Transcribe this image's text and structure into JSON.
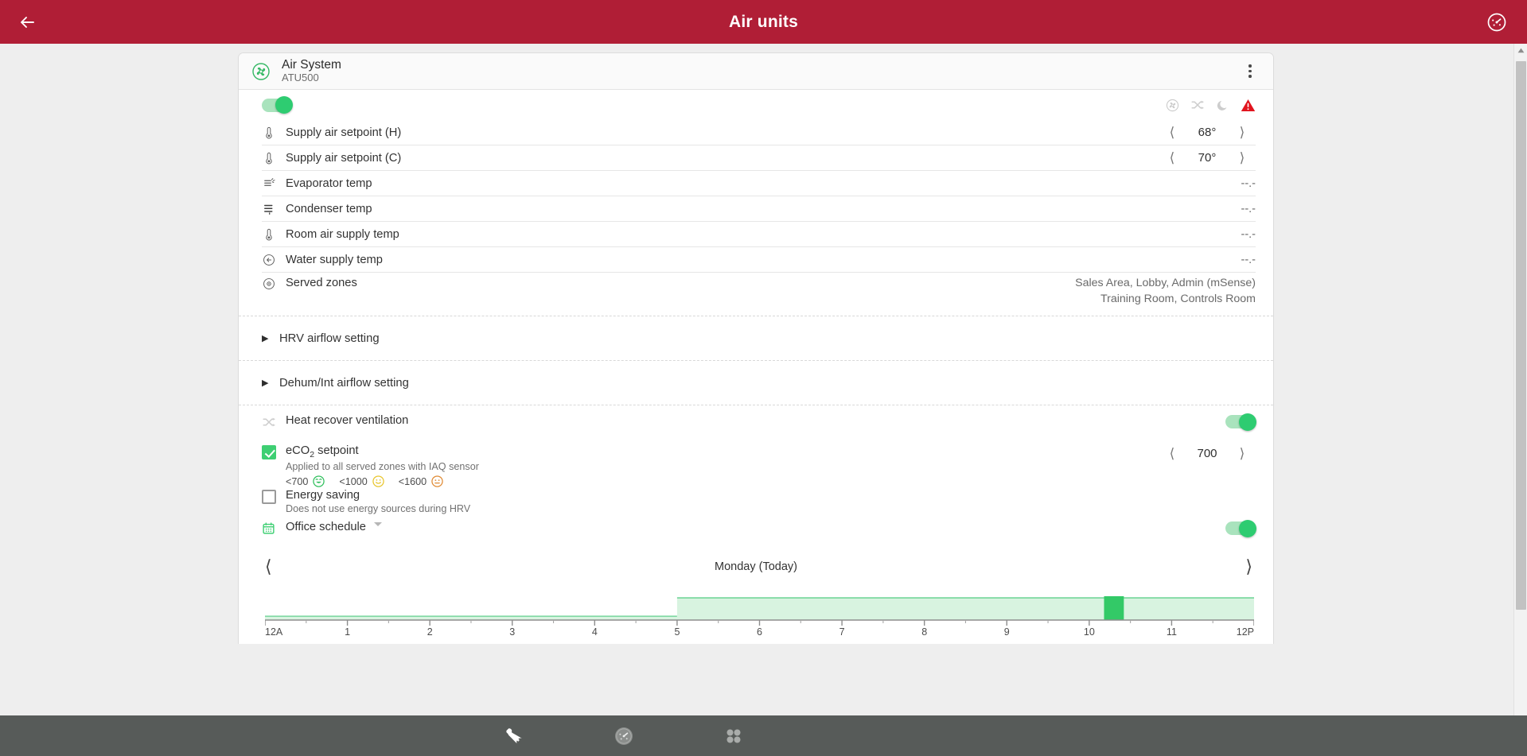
{
  "appbar": {
    "title": "Air units",
    "back_icon": "arrow-left-icon",
    "help_icon": "gauge-icon"
  },
  "card": {
    "title": "Air System",
    "subtitle": "ATU500",
    "unit_icon": "fan-circle-icon",
    "menu_icon": "kebab-menu-icon",
    "power_on": true,
    "status_icons": [
      {
        "name": "fan-status-icon",
        "state": "inactive"
      },
      {
        "name": "hrv-shuffle-status-icon",
        "state": "inactive"
      },
      {
        "name": "night-moon-status-icon",
        "state": "inactive"
      },
      {
        "name": "alarm-warning-icon",
        "state": "active"
      }
    ],
    "rows": [
      {
        "icon": "thermometer-icon",
        "label": "Supply air setpoint (H)",
        "type": "stepper",
        "value": "68°"
      },
      {
        "icon": "thermometer-icon",
        "label": "Supply air setpoint (C)",
        "type": "stepper",
        "value": "70°"
      },
      {
        "icon": "evaporator-icon",
        "label": "Evaporator temp",
        "type": "value",
        "value": "--.-"
      },
      {
        "icon": "condenser-icon",
        "label": "Condenser temp",
        "type": "value",
        "value": "--.-"
      },
      {
        "icon": "thermometer-icon",
        "label": "Room air supply temp",
        "type": "value",
        "value": "--.-"
      },
      {
        "icon": "water-supply-icon",
        "label": "Water supply temp",
        "type": "value",
        "value": "--.-"
      }
    ],
    "served_zones": {
      "icon": "target-circle-icon",
      "label": "Served zones",
      "line1": "Sales Area, Lobby, Admin (mSense)",
      "line2": "Training Room, Controls Room"
    },
    "expandables": [
      {
        "label": "HRV airflow setting",
        "expanded": false
      },
      {
        "label": "Dehum/Int airflow setting",
        "expanded": false
      }
    ],
    "options": {
      "hrv": {
        "icon": "hrv-shuffle-icon",
        "label": "Heat recover ventilation",
        "toggle_on": true
      },
      "eco2": {
        "checked": true,
        "label_prefix": "eCO",
        "label_sub": "2",
        "label_suffix": " setpoint",
        "sub": "Applied to all served zones with IAQ sensor",
        "value": "700",
        "scale": [
          {
            "text": "<700",
            "face": "grin",
            "color": "#2fbf5c"
          },
          {
            "text": "<1000",
            "face": "smile",
            "color": "#e8c52c"
          },
          {
            "text": "<1600",
            "face": "neutral",
            "color": "#e08a33"
          }
        ]
      },
      "energy_saving": {
        "checked": false,
        "label": "Energy saving",
        "sub": "Does not use energy sources during HRV"
      },
      "schedule": {
        "icon": "calendar-icon",
        "label": "Office schedule",
        "dropdown_icon": "caret-down-icon",
        "toggle_on": true
      }
    },
    "timeline": {
      "prev_icon": "chevron-left-icon",
      "next_icon": "chevron-right-icon",
      "day_label": "Monday (Today)",
      "ticks": [
        "12A",
        "1",
        "2",
        "3",
        "4",
        "5",
        "6",
        "7",
        "8",
        "9",
        "10",
        "11",
        "12P"
      ],
      "occupied_start_hour": 5,
      "occupied_end_hour": 12,
      "now_marker_start_hour": 10.18,
      "now_marker_end_hour": 10.42,
      "band_color": "#d8f3e0",
      "band_edge_color": "#7ed9a2",
      "marker_color": "#33c967"
    }
  },
  "bottomnav": {
    "items": [
      {
        "name": "tools-nav-icon",
        "active": true
      },
      {
        "name": "gauge-nav-icon",
        "active": false
      },
      {
        "name": "apps-grid-nav-icon",
        "active": false
      }
    ]
  },
  "scrollbar": {
    "up_icon": "scroll-up-arrow-icon",
    "down_icon": "scroll-down-arrow-icon"
  }
}
